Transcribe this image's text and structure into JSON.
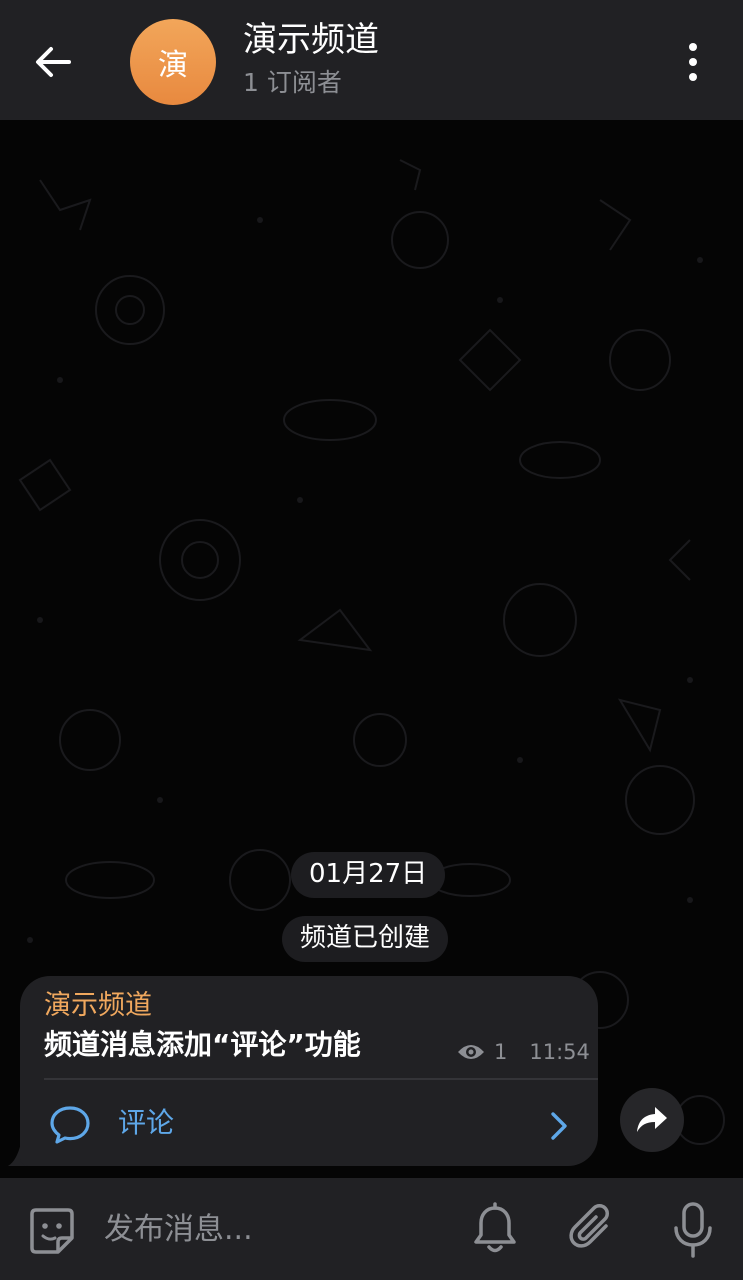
{
  "header": {
    "back_icon": "arrow-left-icon",
    "avatar_letter": "演",
    "title": "演示频道",
    "subtitle": "1 订阅者",
    "menu_icon": "more-vertical-icon",
    "avatar_color": "#EE9A4D"
  },
  "chat": {
    "date_label": "01月27日",
    "service_message": "频道已创建",
    "message": {
      "sender": "演示频道",
      "text": "频道消息添加“评论”功能",
      "views": "1",
      "time": "11:54",
      "views_icon": "eye-icon",
      "comment_label": "评论",
      "comment_icon": "comment-bubble-icon",
      "chevron_icon": "chevron-right-icon"
    },
    "share_icon": "share-arrow-icon"
  },
  "composer": {
    "sticker_icon": "sticker-icon",
    "placeholder": "发布消息...",
    "bell_icon": "bell-icon",
    "attach_icon": "paperclip-icon",
    "mic_icon": "microphone-icon"
  },
  "colors": {
    "header_bg": "#212124",
    "bubble_bg": "#212124",
    "accent_orange": "#F0A85E",
    "link_blue": "#5EA7E8",
    "muted_text": "#8D8F94"
  }
}
